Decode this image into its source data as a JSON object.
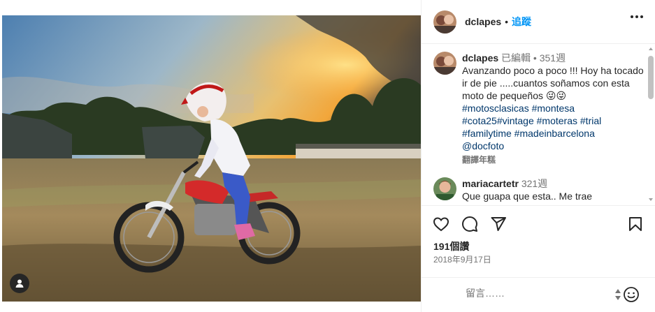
{
  "post": {
    "photo_alt": "",
    "tag_icon": "user-icon"
  },
  "header": {
    "username": "dclapes",
    "separator": "•",
    "follow_label": "追蹤"
  },
  "caption": {
    "username": "dclapes",
    "edited": "已編輯",
    "separator": "•",
    "time": "351週",
    "text": "Avanzando poco a poco !!! Hoy ha tocado ir de pie .....cuantos soñamos con esta moto de pequeños 😜😜",
    "hashtags": "#motosclasicas #montesa #cota25#vintage #moteras #trial #familytime #madeinbarcelona",
    "mention": "@docfoto",
    "translate": "翻譯年糕"
  },
  "comments": [
    {
      "username": "mariacartetr",
      "time": "321週",
      "text": "Que guapa que esta.. Me trae"
    }
  ],
  "actions": {
    "like_icon": "heart-icon",
    "comment_icon": "comment-icon",
    "share_icon": "send-icon",
    "save_icon": "bookmark-icon"
  },
  "likes": "191個讚",
  "date": "2018年9月17日",
  "add_comment": {
    "placeholder": "留言……",
    "emoji_icon": "emoji-icon"
  },
  "colors": {
    "link": "#0095f6",
    "hashtag": "#00376b",
    "muted": "#737373"
  }
}
